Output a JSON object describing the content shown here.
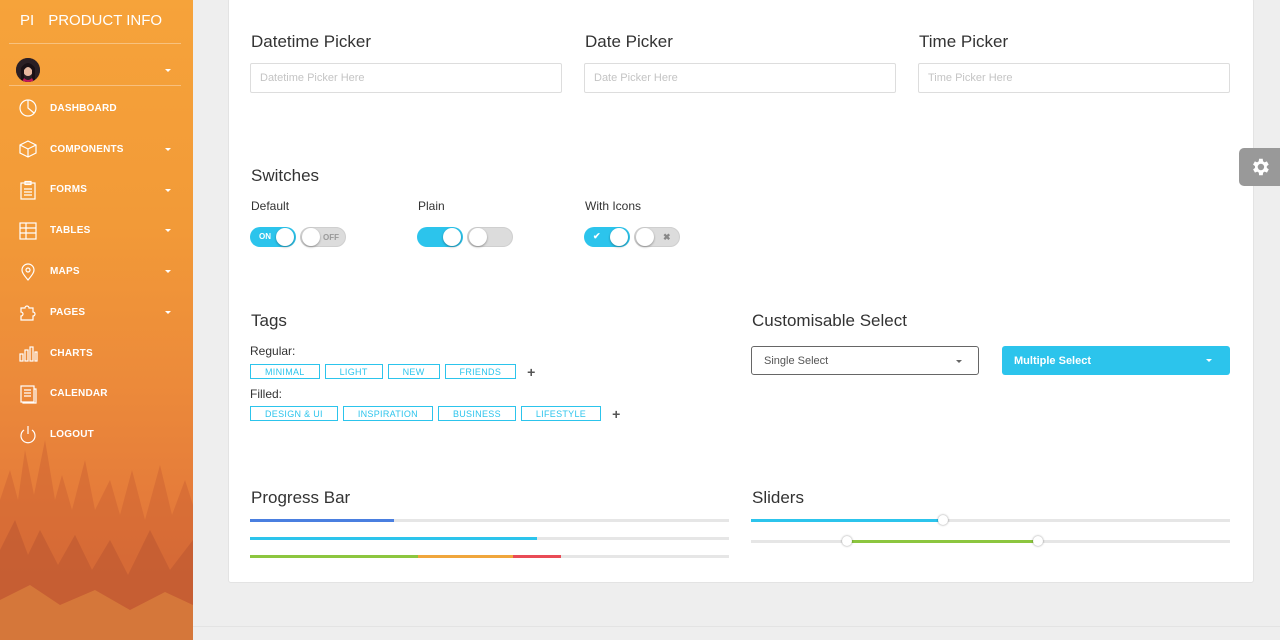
{
  "sidebar": {
    "logo_mini": "PI",
    "logo_text": "PRODUCT INFO",
    "items": [
      {
        "label": "DASHBOARD",
        "icon": "pie-chart-icon",
        "has_caret": false
      },
      {
        "label": "COMPONENTS",
        "icon": "cube-icon",
        "has_caret": true
      },
      {
        "label": "FORMS",
        "icon": "clipboard-icon",
        "has_caret": true
      },
      {
        "label": "TABLES",
        "icon": "table-icon",
        "has_caret": true
      },
      {
        "label": "MAPS",
        "icon": "map-pin-icon",
        "has_caret": true
      },
      {
        "label": "PAGES",
        "icon": "puzzle-icon",
        "has_caret": true
      },
      {
        "label": "CHARTS",
        "icon": "bar-chart-icon",
        "has_caret": false
      },
      {
        "label": "CALENDAR",
        "icon": "calendar-icon",
        "has_caret": false
      },
      {
        "label": "LOGOUT",
        "icon": "power-icon",
        "has_caret": false
      }
    ]
  },
  "pickers": {
    "datetime": {
      "title": "Datetime Picker",
      "placeholder": "Datetime Picker Here"
    },
    "date": {
      "title": "Date Picker",
      "placeholder": "Date Picker Here"
    },
    "time": {
      "title": "Time Picker",
      "placeholder": "Time Picker Here"
    }
  },
  "switches": {
    "title": "Switches",
    "default_label": "Default",
    "plain_label": "Plain",
    "icons_label": "With Icons",
    "on_text": "ON",
    "off_text": "OFF",
    "check_icon": "✔",
    "x_icon": "✖"
  },
  "tags": {
    "title": "Tags",
    "regular_label": "Regular:",
    "regular": [
      "MINIMAL",
      "LIGHT",
      "NEW",
      "FRIENDS"
    ],
    "filled_label": "Filled:",
    "filled": [
      "DESIGN & UI",
      "INSPIRATION",
      "BUSINESS",
      "LIFESTYLE"
    ],
    "add_symbol": "+"
  },
  "select": {
    "title": "Customisable Select",
    "single": "Single Select",
    "multiple": "Multiple Select"
  },
  "progress": {
    "title": "Progress Bar",
    "bars": [
      [
        {
          "value": 0.3,
          "color": "#4a7fe0"
        }
      ],
      [
        {
          "value": 0.6,
          "color": "#2cc4ec"
        }
      ],
      [
        {
          "value": 0.35,
          "color": "#8cc63f"
        },
        {
          "value": 0.2,
          "color": "#f0a63c"
        },
        {
          "value": 0.1,
          "color": "#e94b56"
        }
      ]
    ]
  },
  "sliders": {
    "title": "Sliders",
    "single": {
      "value": 0.4,
      "color": "#2cc4ec"
    },
    "range": {
      "low": 0.2,
      "high": 0.6,
      "color": "#8cc63f"
    }
  },
  "colors": {
    "accent": "#2cc4ec",
    "sidebar_top": "#f6a33a",
    "sidebar_bottom": "#d96a3a"
  }
}
